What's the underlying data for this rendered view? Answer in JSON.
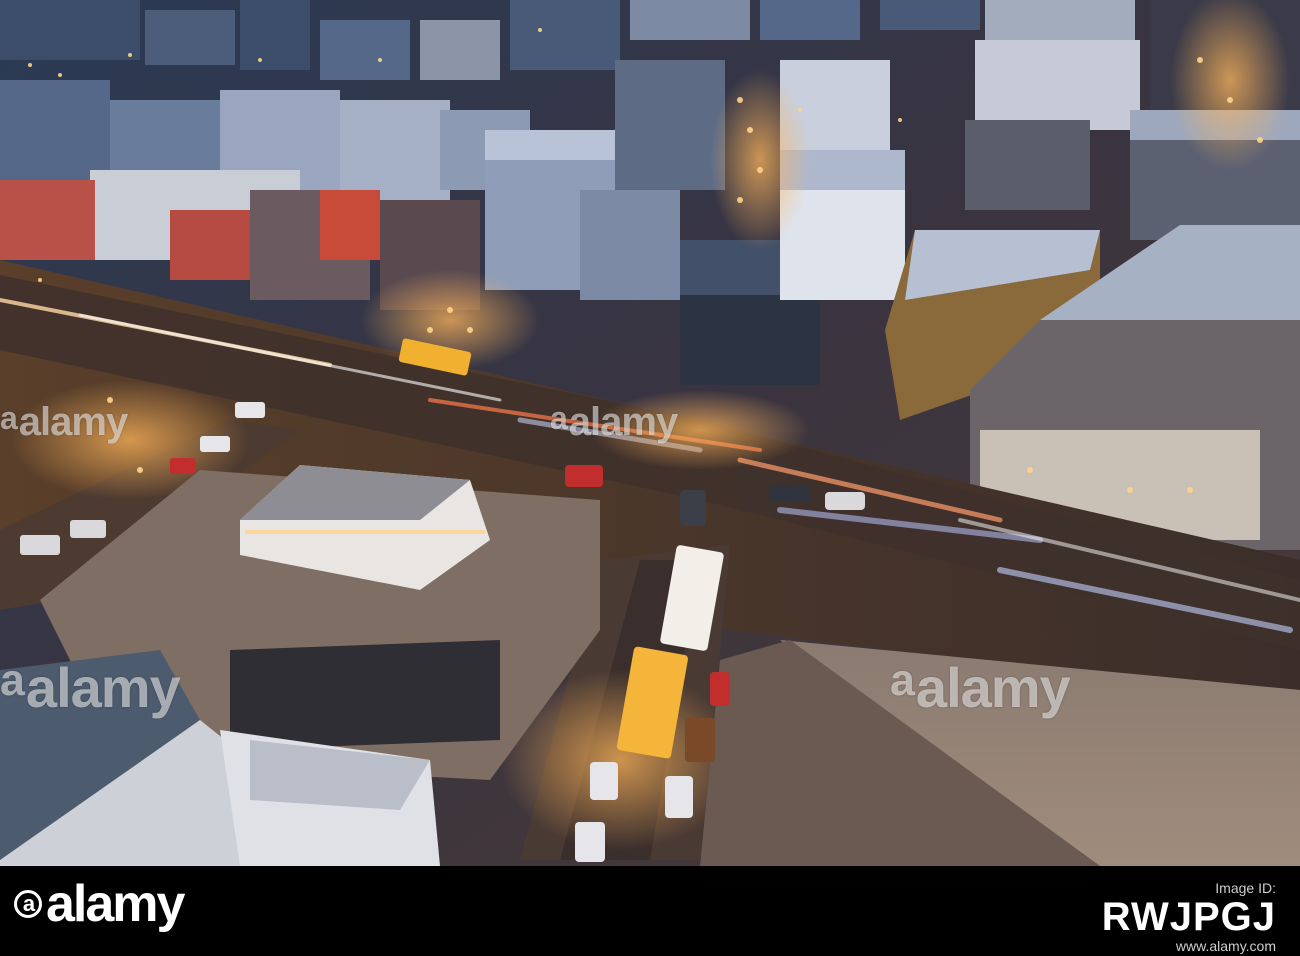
{
  "watermark": {
    "brand": "alamy",
    "symbol": "a"
  },
  "footer": {
    "logo_text": "alamy",
    "logo_symbol": "a",
    "image_id_label": "Image ID:",
    "image_id": "RWJPGJ",
    "url": "www.alamy.com"
  },
  "colors": {
    "footer_bg": "#000000",
    "night_sky_blue": "#1f2a3c",
    "street_glow": "#e89a3c"
  }
}
